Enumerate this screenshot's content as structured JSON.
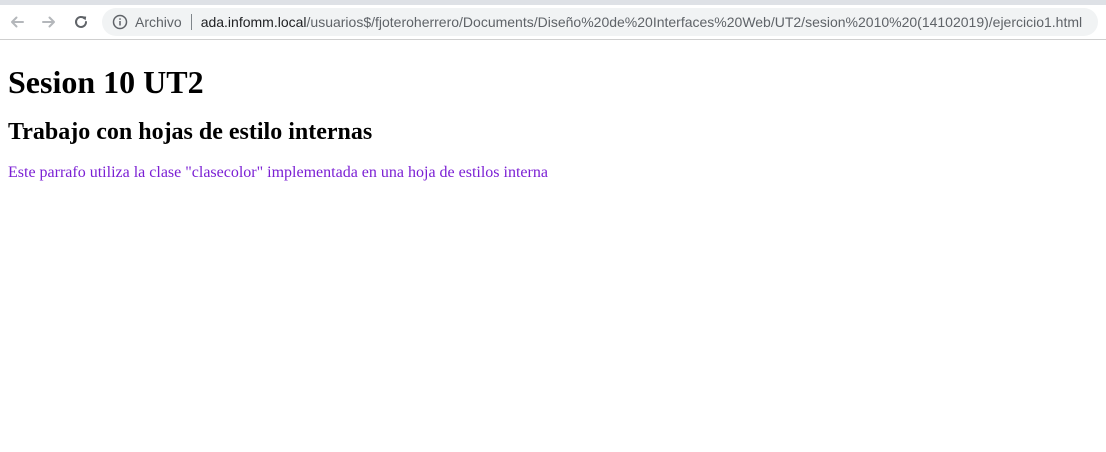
{
  "browser": {
    "omnibox": {
      "security_label": "Archivo",
      "url_host": "ada.infomm.local",
      "url_path": "/usuarios$/fjoteroherrero/Documents/Dise%C3%B1o%20de%20Interfaces%20Web/UT2/sesion%2010%20(14102019)/ejercicio1.html"
    },
    "icons": {
      "back": "arrow-left-icon",
      "forward": "arrow-right-icon",
      "reload": "reload-icon",
      "info": "info-icon"
    }
  },
  "page": {
    "heading1": "Sesion 10 UT2",
    "heading2": "Trabajo con hojas de estilo internas",
    "paragraph": "Este parrafo utiliza la clase \"clasecolor\" implementada en una hoja de estilos interna",
    "paragraph_color": "#7b1fd4"
  }
}
